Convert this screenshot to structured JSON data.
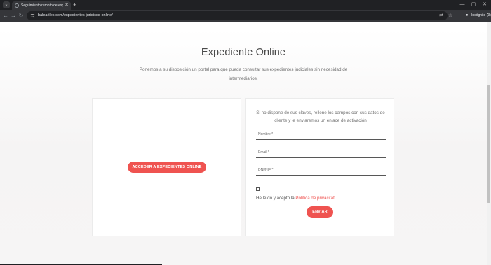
{
  "browser": {
    "tab_menu_icon": "⌄",
    "tab_title": "Seguimiento remoto de expedi...",
    "tab_close": "✕",
    "new_tab": "+",
    "window_controls": {
      "minimize": "—",
      "restore": "▢",
      "close": "✕"
    },
    "nav": {
      "back": "←",
      "forward": "→",
      "reload": "↻"
    },
    "url": "baleariles.com/expedientes-juridicos-online/",
    "omnibox_icons": {
      "translate": "⇄",
      "bookmark": "☆"
    },
    "incognito_label": "Incógnito (3)",
    "menu_icon": "⋮"
  },
  "page": {
    "title": "Expediente Online",
    "intro": "Ponemos a su disposición un portal para que pueda consultar sus expedientes judiciales sin necesidad de intermediarios.",
    "access_button": "ACCEDER A EXPEDIENTES ONLINE",
    "form": {
      "description": "Si no dispone de sus claves, rellene los campos con sus datos de cliente y le enviaremos un enlace de activación",
      "fields": [
        {
          "label": "Nombre *",
          "value": ""
        },
        {
          "label": "Email *",
          "value": ""
        },
        {
          "label": "DNI/NIF *",
          "value": ""
        }
      ],
      "consent_prefix": "He leído y acepto la ",
      "consent_link": "Política de privacitat.",
      "consent_checked": false,
      "submit": "ENVIAR"
    }
  },
  "colors": {
    "accent": "#ef5350",
    "chrome_dark": "#202124",
    "chrome_mid": "#35363a"
  }
}
